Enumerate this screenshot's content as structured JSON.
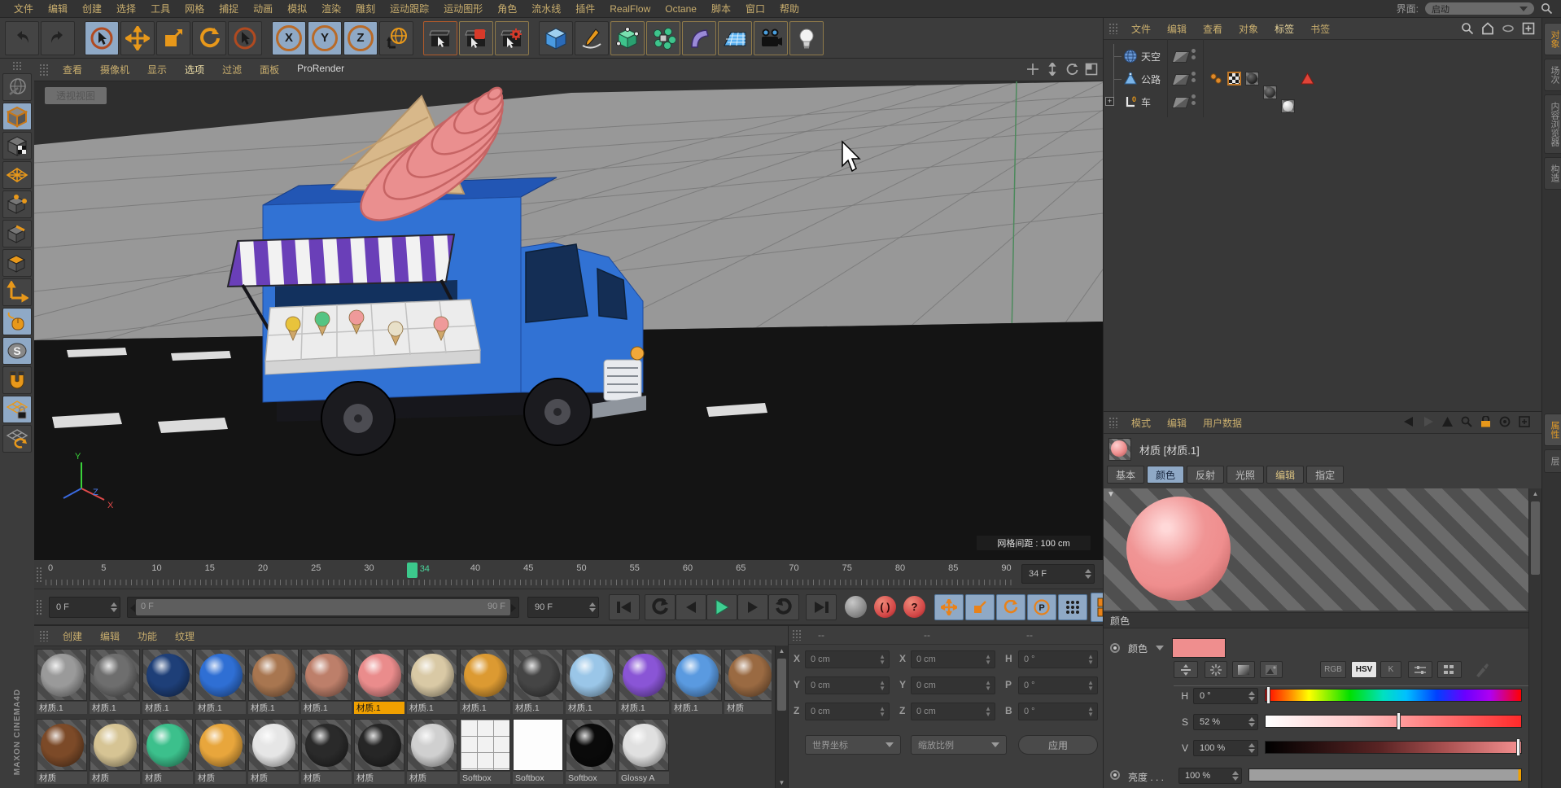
{
  "colors": {
    "accent_orange": "#f0a000",
    "active_blue": "#8fa9c6",
    "material_pink": "#ef8e8e"
  },
  "menubar": {
    "items": [
      "文件",
      "编辑",
      "创建",
      "选择",
      "工具",
      "网格",
      "捕捉",
      "动画",
      "模拟",
      "渲染",
      "雕刻",
      "运动跟踪",
      "运动图形",
      "角色",
      "流水线",
      "插件",
      "RealFlow",
      "Octane",
      "脚本",
      "窗口",
      "帮助"
    ],
    "interface_label": "界面:",
    "interface_value": "启动"
  },
  "toolbar": {
    "axis_x": "X",
    "axis_y": "Y",
    "axis_z": "Z"
  },
  "viewport": {
    "menu": [
      "查看",
      "摄像机",
      "显示",
      "选项",
      "过滤",
      "面板",
      "ProRender"
    ],
    "active_menu": "选项",
    "view_label": "透视视图",
    "grid_spacing_label": "网格间距 : 100 cm"
  },
  "timeline": {
    "ticks": [
      0,
      5,
      10,
      15,
      20,
      25,
      30,
      40,
      45,
      50,
      55,
      60,
      65,
      70,
      75,
      80,
      85,
      90
    ],
    "current_frame": 34,
    "frame_field": "34 F"
  },
  "transport": {
    "current": "0 F",
    "range_start": "0 F",
    "range_end": "90 F",
    "end": "90 F"
  },
  "materials": {
    "menu": [
      "创建",
      "编辑",
      "功能",
      "纹理"
    ],
    "row1": [
      {
        "label": "材质.1",
        "color": "#9a9a9a"
      },
      {
        "label": "材质.1",
        "color": "#6e6e6e"
      },
      {
        "label": "材质.1",
        "color": "#1e3f78"
      },
      {
        "label": "材质.1",
        "color": "#2f6fd4"
      },
      {
        "label": "材质.1",
        "color": "#a87650"
      },
      {
        "label": "材质.1",
        "color": "#bd7f6a"
      },
      {
        "label": "材质.1",
        "color": "#ea8c8c",
        "selected": true
      },
      {
        "label": "材质.1",
        "color": "#d9c9a5"
      },
      {
        "label": "材质.1",
        "color": "#dc9a32"
      },
      {
        "label": "材质.1",
        "color": "#454545"
      },
      {
        "label": "材质.1",
        "color": "#9ac6e8"
      },
      {
        "label": "材质.1",
        "color": "#8a55d6"
      },
      {
        "label": "材质.1",
        "color": "#5a9ae0"
      },
      {
        "label": "材质",
        "color": "#9a6a42"
      }
    ],
    "row2": [
      {
        "label": "材质",
        "color": "#7c4a28"
      },
      {
        "label": "材质",
        "color": "#d6c494"
      },
      {
        "label": "材质",
        "color": "#3cc08c"
      },
      {
        "label": "材质",
        "color": "#e8a63c"
      },
      {
        "label": "材质",
        "color": "#e6e6e6"
      },
      {
        "label": "材质",
        "color": "#2a2a2a"
      },
      {
        "label": "材质",
        "color": "#262626"
      },
      {
        "label": "材质",
        "color": "#d0d0d0"
      },
      {
        "label": "Softbox",
        "kind": "grid"
      },
      {
        "label": "Softbox",
        "kind": "flat"
      },
      {
        "label": "Softbox",
        "color": "#0a0a0a"
      },
      {
        "label": "Glossy A",
        "color": "#e0e0e0"
      }
    ]
  },
  "coords": {
    "headers": [
      "--",
      "--",
      "--"
    ],
    "rows": [
      {
        "l1": "X",
        "v1": "0 cm",
        "l2": "X",
        "v2": "0 cm",
        "l3": "H",
        "v3": "0 °"
      },
      {
        "l1": "Y",
        "v1": "0 cm",
        "l2": "Y",
        "v2": "0 cm",
        "l3": "P",
        "v3": "0 °"
      },
      {
        "l1": "Z",
        "v1": "0 cm",
        "l2": "Z",
        "v2": "0 cm",
        "l3": "B",
        "v3": "0 °"
      }
    ],
    "combo_world": "世界坐标",
    "combo_scale": "缩放比例",
    "apply": "应用"
  },
  "object_manager": {
    "menu": [
      "文件",
      "编辑",
      "查看",
      "对象",
      "标签",
      "书签"
    ],
    "active_menu": "标签",
    "objects": [
      {
        "name": "天空"
      },
      {
        "name": "公路"
      },
      {
        "name": "车"
      }
    ]
  },
  "right_tabs": {
    "top": [
      "对象",
      "场次",
      "内容浏览器",
      "构造"
    ],
    "bottom": [
      "属性",
      "层"
    ]
  },
  "attributes": {
    "menu": [
      "模式",
      "编辑",
      "用户数据"
    ],
    "title": "材质 [材质.1]",
    "tabs": [
      "基本",
      "颜色",
      "反射",
      "光照",
      "编辑",
      "指定"
    ],
    "active_tab": "颜色",
    "highlight_tab": "编辑",
    "color_section": {
      "header": "颜色",
      "color_label": "颜色",
      "swatch": "#ef8e8e",
      "mode_rgb": "RGB",
      "mode_hsv": "HSV",
      "mode_k": "K",
      "h_label": "H",
      "h_value": "0 °",
      "h_percent": 1,
      "s_label": "S",
      "s_value": "52 %",
      "s_percent": 52,
      "v_label": "V",
      "v_value": "100 %",
      "v_percent": 99,
      "brightness_label": "亮度 . . .",
      "brightness_value": "100 %"
    }
  },
  "branding": {
    "vertical": "MAXON CINEMA4D"
  }
}
